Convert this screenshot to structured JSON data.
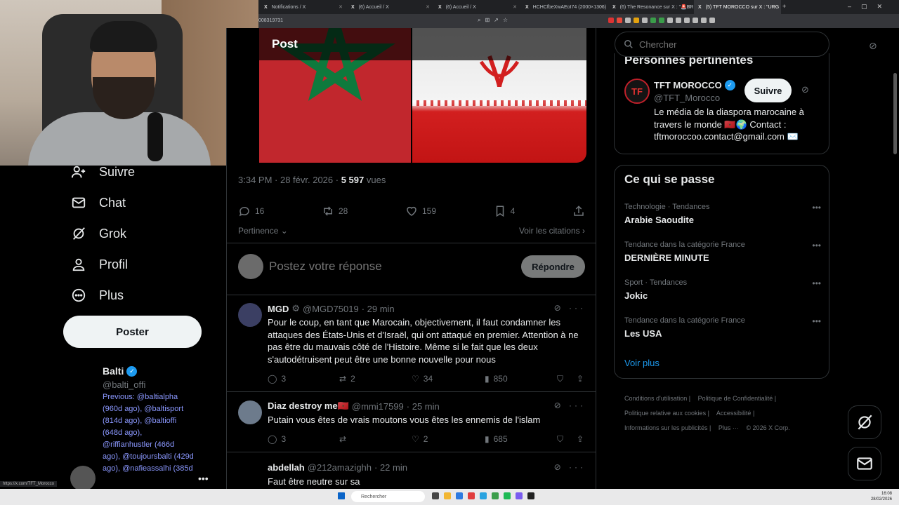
{
  "browser": {
    "tabs": [
      {
        "label": "Notifications / X"
      },
      {
        "label": "(6) Accueil / X"
      },
      {
        "label": "(6) Accueil / X"
      },
      {
        "label": "HCHCfbeXwAEoI74 (2000×1306)"
      },
      {
        "label": "(6) The Resonance sur X : \"🚨BREAK"
      },
      {
        "label": "(5) TFT MOROCCO sur X : \"URG"
      }
    ],
    "url_fragment": "008319731",
    "status_url": "https://x.com/TFT_Morocco"
  },
  "nav": {
    "items": [
      {
        "label": "Suivre",
        "icon": "follow-icon"
      },
      {
        "label": "Chat",
        "icon": "mail-icon"
      },
      {
        "label": "Grok",
        "icon": "grok-icon"
      },
      {
        "label": "Profil",
        "icon": "person-icon"
      },
      {
        "label": "Plus",
        "icon": "more-circle-icon"
      }
    ],
    "post_button": "Poster",
    "account": {
      "name": "Balti",
      "handle": "@balti_offi",
      "previous": "Previous: @baltialpha (960d ago), @baltisport (814d ago), @baltioffi (648d ago), @riffianhustler (466d ago), @toujoursbalti (429d ago), @nafieassalhi (385d"
    }
  },
  "post": {
    "header": "Post",
    "time": "3:34 PM · 28 févr. 2026 · ",
    "views_count": "5 597",
    "views_label": " vues",
    "stats": {
      "replies": "16",
      "reposts": "28",
      "likes": "159",
      "bookmarks": "4"
    },
    "sort_label": "Pertinence",
    "quotes_link": "Voir les citations",
    "reply_placeholder": "Postez votre réponse",
    "reply_button": "Répondre"
  },
  "replies": [
    {
      "name": "MGD",
      "handle": "@MGD75019",
      "time": "· 29 min",
      "text": "Pour le coup, en tant que Marocain, objectivement, il faut condamner les attaques des États-Unis et d'Israël, qui ont attaqué en premier. Attention à ne pas être du mauvais côté de l'Histoire. Même si le fait que les deux s'autodétruisent peut être une bonne nouvelle pour nous",
      "replies": "3",
      "reposts": "2",
      "likes": "34",
      "views": "850"
    },
    {
      "name": "Diaz destroy me🇲🇦",
      "handle": "@mmi17599",
      "time": "· 25 min",
      "text": "Putain vous êtes de vrais moutons vous êtes les ennemis de l'islam",
      "replies": "3",
      "reposts": "",
      "likes": "2",
      "views": "685"
    },
    {
      "name": "abdellah",
      "handle": "@212amazighh",
      "time": "· 22 min",
      "text": "Faut être neutre sur sa"
    }
  ],
  "right": {
    "search_placeholder": "Chercher",
    "relevant_title": "Personnes pertinentes",
    "relevant": {
      "name": "TFT MOROCCO",
      "handle": "@TFT_Morocco",
      "follow": "Suivre",
      "bio": "Le média de la diaspora marocaine à travers le monde 🇲🇦🌍 Contact : tftmoroccoo.contact@gmail.com ✉️"
    },
    "trends_title": "Ce qui se passe",
    "trends": [
      {
        "context": "Technologie · Tendances",
        "name": "Arabie Saoudite"
      },
      {
        "context": "Tendance dans la catégorie France",
        "name": "DERNIÈRE MINUTE"
      },
      {
        "context": "Sport · Tendances",
        "name": "Jokic"
      },
      {
        "context": "Tendance dans la catégorie France",
        "name": "Les USA"
      }
    ],
    "see_more": "Voir plus",
    "footer": [
      "Conditions d'utilisation |",
      "Politique de Confidentialité |",
      "Politique relative aux cookies |",
      "Accessibilité |",
      "Informations sur les publicités |",
      "Plus ···",
      "© 2026 X Corp."
    ]
  },
  "taskbar": {
    "search": "Rechercher",
    "time": "16:08",
    "date": "28/02/2026"
  }
}
